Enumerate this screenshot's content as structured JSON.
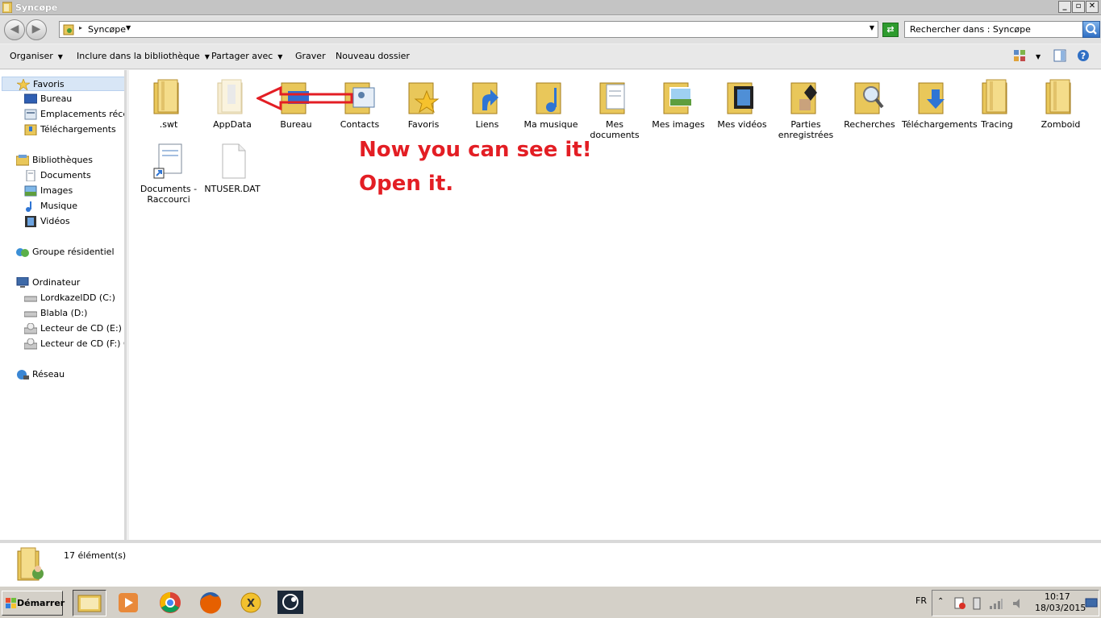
{
  "window": {
    "title": "Syncøpe"
  },
  "address": {
    "crumb": "Syncøpe",
    "search_placeholder": "Rechercher dans : Syncøpe"
  },
  "toolbar": {
    "organize": "Organiser",
    "include_library": "Inclure dans la bibliothèque",
    "share_with": "Partager avec",
    "burn": "Graver",
    "new_folder": "Nouveau dossier"
  },
  "nav": {
    "favorites": "Favoris",
    "favorites_items": [
      "Bureau",
      "Emplacements récents",
      "Téléchargements"
    ],
    "libraries": "Bibliothèques",
    "libraries_items": [
      "Documents",
      "Images",
      "Musique",
      "Vidéos"
    ],
    "homegroup": "Groupe résidentiel",
    "computer": "Ordinateur",
    "computer_items": [
      "LordkazelDD (C:)",
      "Blabla (D:)",
      "Lecteur de CD (E:)",
      "Lecteur de CD (F:) CO"
    ],
    "network": "Réseau"
  },
  "files": [
    {
      "name": ".swt",
      "icon": "folder-icon"
    },
    {
      "name": "AppData",
      "icon": "folder-hidden-icon"
    },
    {
      "name": "Bureau",
      "icon": "folder-desktop-icon"
    },
    {
      "name": "Contacts",
      "icon": "folder-contacts-icon"
    },
    {
      "name": "Favoris",
      "icon": "folder-favorites-icon"
    },
    {
      "name": "Liens",
      "icon": "folder-links-icon"
    },
    {
      "name": "Ma musique",
      "icon": "folder-music-icon"
    },
    {
      "name": "Mes documents",
      "icon": "folder-documents-icon"
    },
    {
      "name": "Mes images",
      "icon": "folder-pictures-icon"
    },
    {
      "name": "Mes vidéos",
      "icon": "folder-videos-icon"
    },
    {
      "name": "Parties enregistrées",
      "icon": "folder-games-icon"
    },
    {
      "name": "Recherches",
      "icon": "folder-search-icon"
    },
    {
      "name": "Téléchargements",
      "icon": "folder-downloads-icon"
    },
    {
      "name": "Tracing",
      "icon": "folder-icon"
    },
    {
      "name": "Zomboid",
      "icon": "folder-icon"
    },
    {
      "name": "Documents - Raccourci",
      "icon": "shortcut-icon"
    },
    {
      "name": "NTUSER.DAT",
      "icon": "file-icon"
    }
  ],
  "annotation": {
    "line1": "Now you can see it!",
    "line2": "Open it.",
    "color": "#e31e24"
  },
  "details": {
    "count": "17 élément(s)"
  },
  "taskbar": {
    "start": "Démarrer",
    "lang": "FR",
    "time": "10:17",
    "date": "18/03/2015"
  }
}
